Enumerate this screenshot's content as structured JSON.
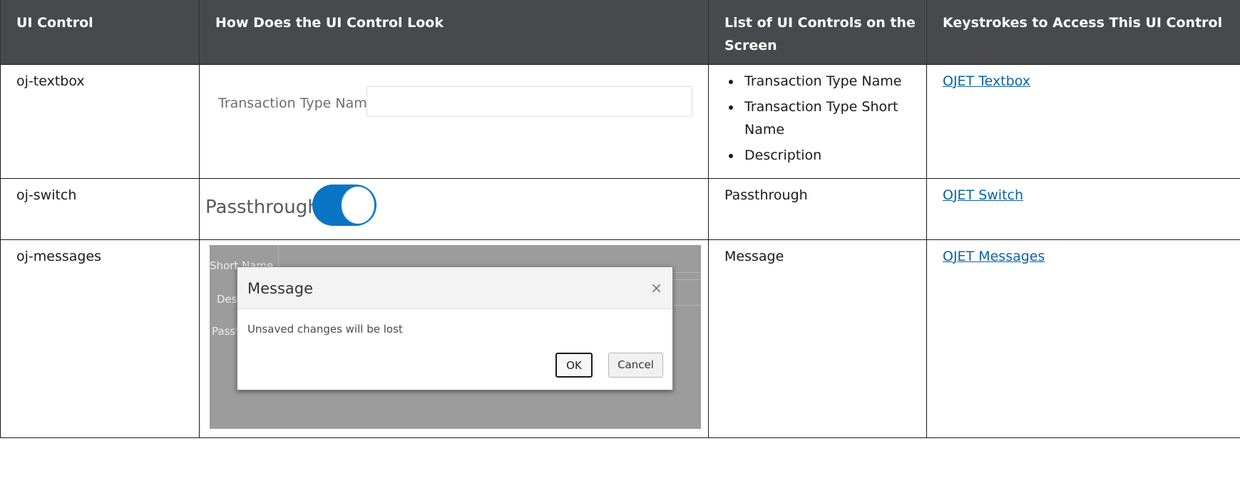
{
  "header": {
    "col1": "UI Control",
    "col2": "How Does the UI Control Look",
    "col3": "List of UI Controls on the Screen",
    "col4": "Keystrokes to Access This UI Control"
  },
  "rows": [
    {
      "control": "oj-textbox",
      "preview": {
        "label": "Transaction Type Name",
        "value": ""
      },
      "controls_list": [
        "Transaction Type Name",
        "Transaction Type Short Name",
        "Description"
      ],
      "link": "OJET Textbox"
    },
    {
      "control": "oj-switch",
      "preview": {
        "label": "Passthrough",
        "state": "on"
      },
      "controls_text": "Passthrough",
      "link": "OJET Switch"
    },
    {
      "control": "oj-messages",
      "preview": {
        "bg_short_name": "Short Name",
        "bg_desc": "Des",
        "bg_pass": "Passt",
        "dialog_title": "Message",
        "close_glyph": "×",
        "message": "Unsaved changes will be lost",
        "ok_label": "OK",
        "cancel_label": "Cancel"
      },
      "controls_text": "Message",
      "link": "OJET Messages"
    }
  ],
  "colors": {
    "header_bg": "#47494c",
    "link": "#0b62a6",
    "switch_on": "#0a74c4",
    "overlay": "#9c9c9c"
  }
}
